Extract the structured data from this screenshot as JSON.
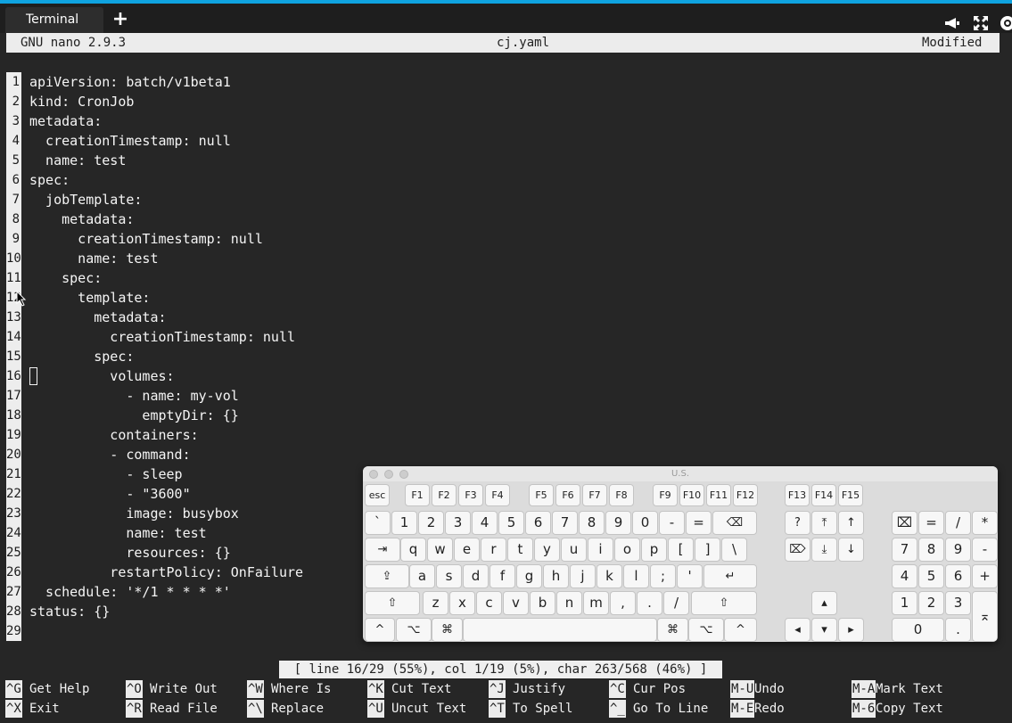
{
  "tab": {
    "label": "Terminal",
    "new_tab": "+"
  },
  "toolbar_icons": [
    "megaphone-icon",
    "fullscreen-icon",
    "gear-icon"
  ],
  "nano": {
    "version": "GNU nano 2.9.3",
    "filename": "cj.yaml",
    "state": "Modified"
  },
  "lines": [
    {
      "n": "1",
      "text": "apiVersion: batch/v1beta1"
    },
    {
      "n": "2",
      "text": "kind: CronJob"
    },
    {
      "n": "3",
      "text": "metadata:"
    },
    {
      "n": "4",
      "text": "  creationTimestamp: null"
    },
    {
      "n": "5",
      "text": "  name: test"
    },
    {
      "n": "6",
      "text": "spec:"
    },
    {
      "n": "7",
      "text": "  jobTemplate:"
    },
    {
      "n": "8",
      "text": "    metadata:"
    },
    {
      "n": "9",
      "text": "      creationTimestamp: null"
    },
    {
      "n": "10",
      "text": "      name: test"
    },
    {
      "n": "11",
      "text": "    spec:"
    },
    {
      "n": "12",
      "text": "      template:"
    },
    {
      "n": "13",
      "text": "        metadata:"
    },
    {
      "n": "14",
      "text": "          creationTimestamp: null"
    },
    {
      "n": "15",
      "text": "        spec:"
    },
    {
      "n": "16",
      "text": "          volumes:"
    },
    {
      "n": "17",
      "text": "            - name: my-vol"
    },
    {
      "n": "18",
      "text": "              emptyDir: {}"
    },
    {
      "n": "19",
      "text": "          containers:"
    },
    {
      "n": "20",
      "text": "          - command:"
    },
    {
      "n": "21",
      "text": "            - sleep"
    },
    {
      "n": "22",
      "text": "            - \"3600\""
    },
    {
      "n": "23",
      "text": "            image: busybox"
    },
    {
      "n": "24",
      "text": "            name: test"
    },
    {
      "n": "25",
      "text": "            resources: {}"
    },
    {
      "n": "26",
      "text": "          restartPolicy: OnFailure"
    },
    {
      "n": "27",
      "text": "  schedule: '*/1 * * * *'"
    },
    {
      "n": "28",
      "text": "status: {}"
    },
    {
      "n": "29",
      "text": ""
    }
  ],
  "status_message": "[ line 16/29 (55%), col 1/19 (5%), char 263/568 (46%) ]",
  "shortcuts": [
    {
      "key": "^G",
      "label": "Get Help"
    },
    {
      "key": "^O",
      "label": "Write Out"
    },
    {
      "key": "^W",
      "label": "Where Is"
    },
    {
      "key": "^K",
      "label": "Cut Text"
    },
    {
      "key": "^J",
      "label": "Justify"
    },
    {
      "key": "^C",
      "label": "Cur Pos"
    },
    {
      "key": "M-U",
      "label": "Undo"
    },
    {
      "key": "M-A",
      "label": "Mark Text"
    },
    {
      "key": "^X",
      "label": "Exit"
    },
    {
      "key": "^R",
      "label": "Read File"
    },
    {
      "key": "^\\",
      "label": "Replace"
    },
    {
      "key": "^U",
      "label": "Uncut Text"
    },
    {
      "key": "^T",
      "label": "To Spell"
    },
    {
      "key": "^_",
      "label": "Go To Line"
    },
    {
      "key": "M-E",
      "label": "Redo"
    },
    {
      "key": "M-6",
      "label": "Copy Text"
    }
  ],
  "keyboard": {
    "title": "U.S.",
    "fkeys": [
      "esc",
      "F1",
      "F2",
      "F3",
      "F4",
      "F5",
      "F6",
      "F7",
      "F8",
      "F9",
      "F10",
      "F11",
      "F12",
      "F13",
      "F14",
      "F15"
    ],
    "row1": [
      "`",
      "1",
      "2",
      "3",
      "4",
      "5",
      "6",
      "7",
      "8",
      "9",
      "0",
      "-",
      "=",
      "⌫"
    ],
    "row2": [
      "⇥",
      "q",
      "w",
      "e",
      "r",
      "t",
      "y",
      "u",
      "i",
      "o",
      "p",
      "[",
      "]",
      "\\"
    ],
    "row3": [
      "⇪",
      "a",
      "s",
      "d",
      "f",
      "g",
      "h",
      "j",
      "k",
      "l",
      ";",
      "'",
      "↵"
    ],
    "row4": [
      "⇧",
      "z",
      "x",
      "c",
      "v",
      "b",
      "n",
      "m",
      ",",
      ".",
      "/",
      "⇧"
    ],
    "row5": [
      "^",
      "⌥",
      "⌘",
      "",
      "⌘",
      "⌥",
      "^"
    ],
    "nav": [
      "?",
      "⤒",
      "↑",
      "⌦",
      "⤓",
      "↓"
    ],
    "arrows": [
      "▴",
      "◂",
      "▾",
      "▸"
    ],
    "numpad": [
      "⌧",
      "=",
      "/",
      "*",
      "7",
      "8",
      "9",
      "-",
      "4",
      "5",
      "6",
      "+",
      "1",
      "2",
      "3",
      "⌅",
      "0",
      "."
    ]
  }
}
